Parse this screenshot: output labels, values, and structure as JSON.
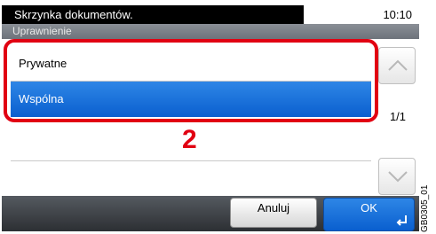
{
  "header": {
    "title": "Skrzynka dokumentów.",
    "time": "10:10"
  },
  "subheader": {
    "label": "Uprawnienie"
  },
  "options": [
    {
      "label": "Prywatne",
      "selected": false
    },
    {
      "label": "Wspólna",
      "selected": true
    }
  ],
  "annotation": {
    "step": "2"
  },
  "pager": {
    "counter": "1/1"
  },
  "footer": {
    "cancel_label": "Anuluj",
    "ok_label": "OK"
  },
  "figure_code": "GB0305_01",
  "colors": {
    "accent_red": "#e10012",
    "selected_blue": "#0a5fcf"
  },
  "icons": {
    "scroll_up": "chevron-up-icon",
    "scroll_down": "chevron-down-icon",
    "enter": "enter-return-icon"
  }
}
